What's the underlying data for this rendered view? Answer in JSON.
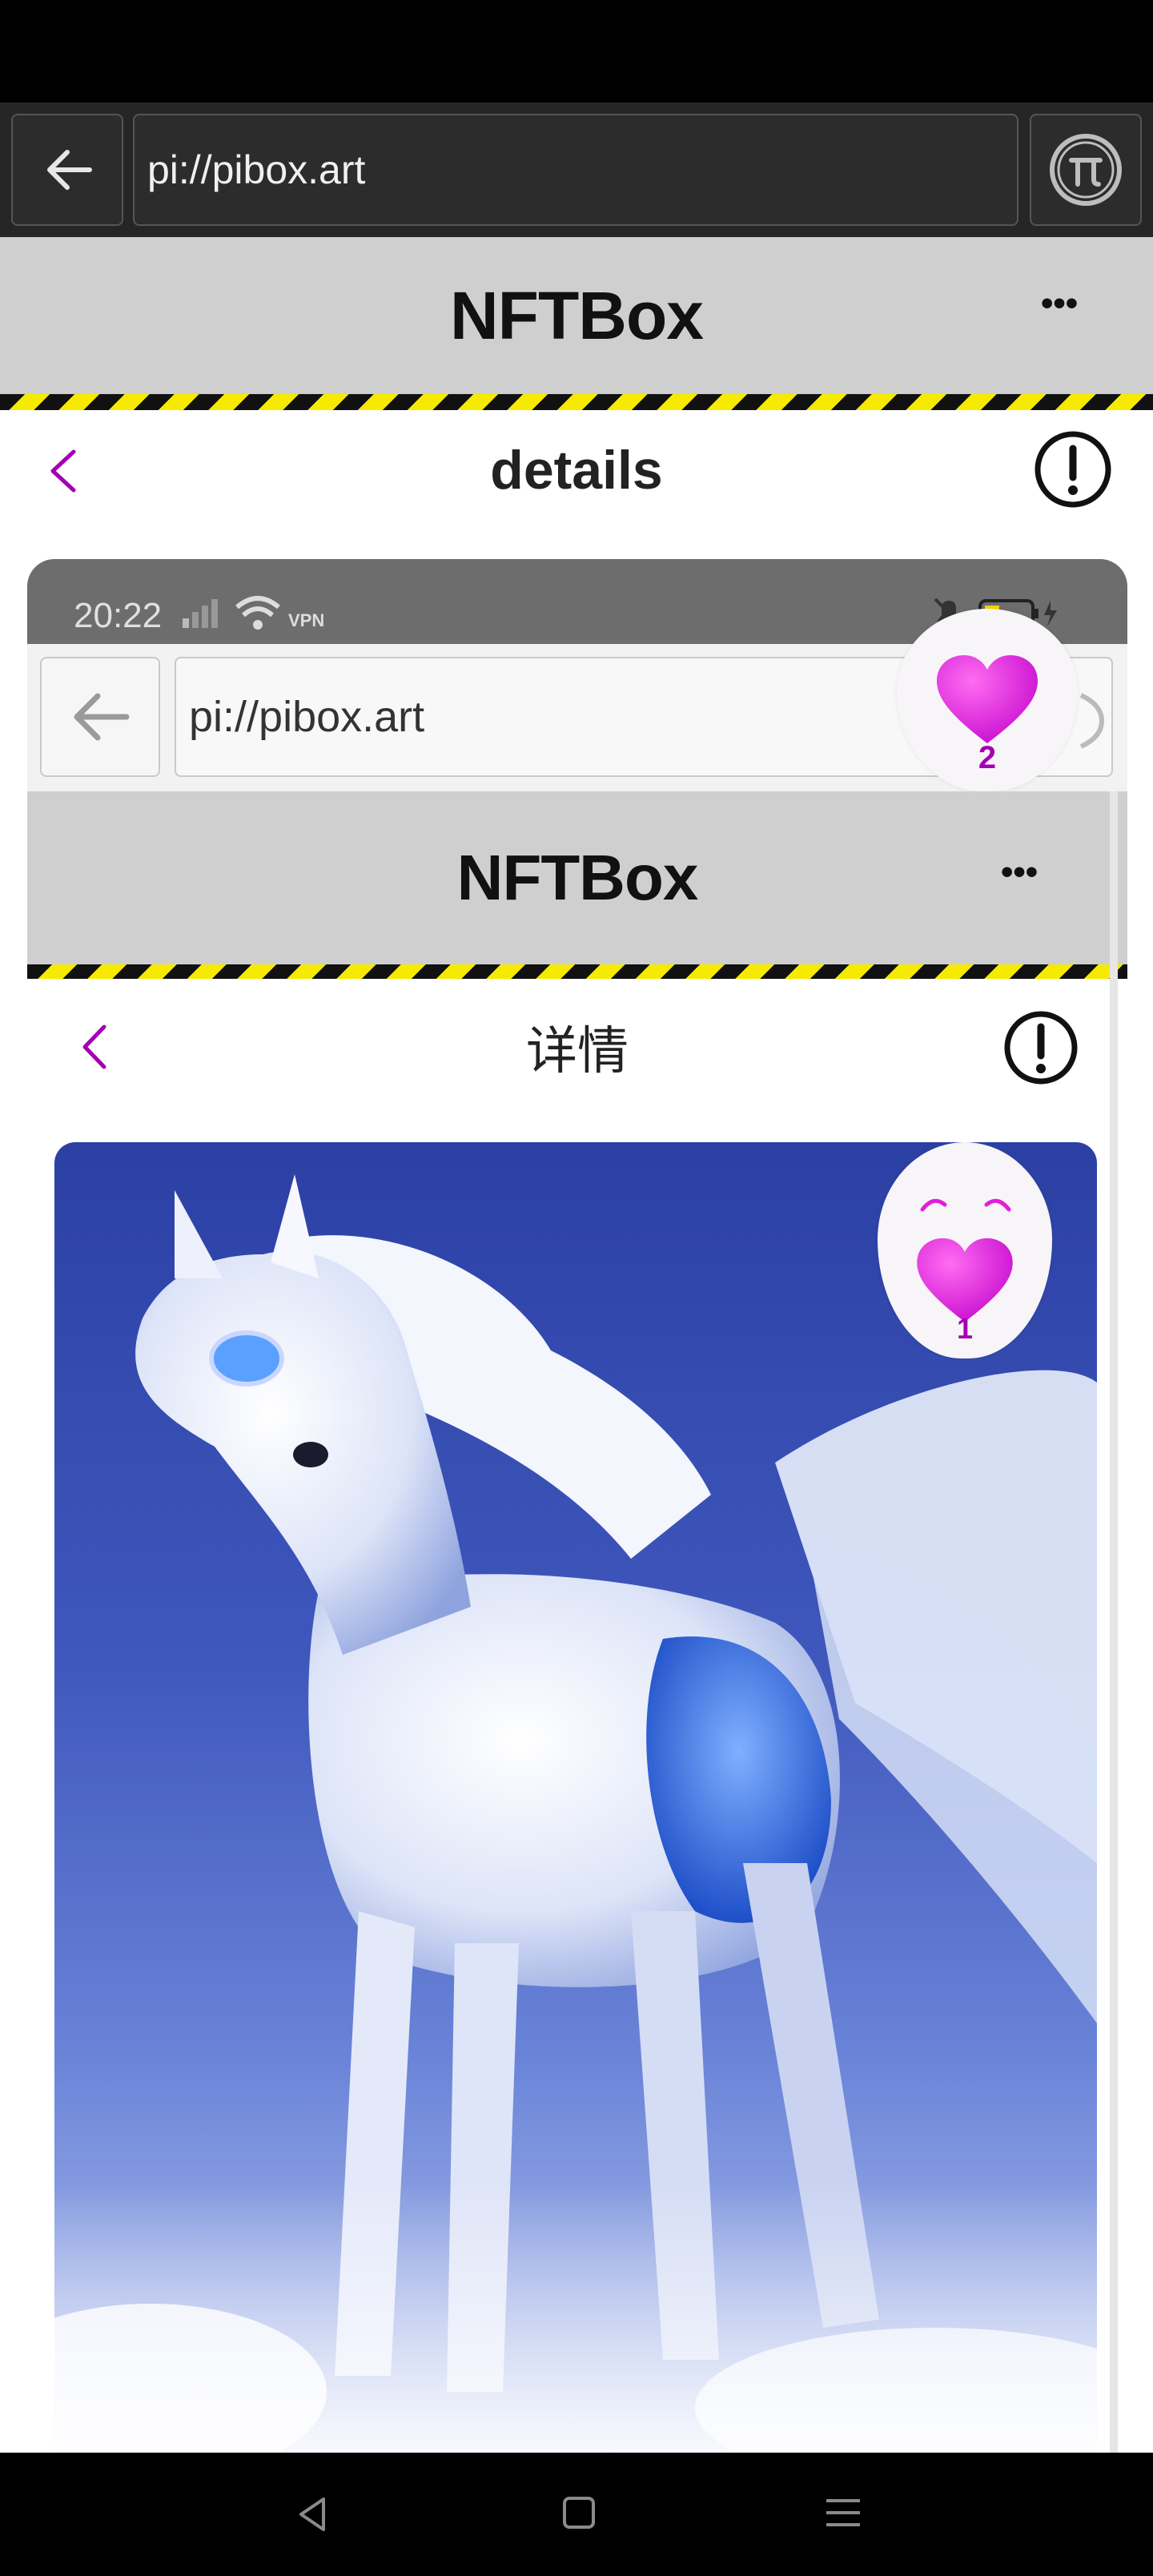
{
  "browser": {
    "url": "pi://pibox.art"
  },
  "site": {
    "title": "NFTBox",
    "more": "•••"
  },
  "page": {
    "title": "details"
  },
  "screenshot": {
    "status_time": "20:22",
    "status_vpn": "VPN",
    "browser_url": "pi://pibox.art",
    "site_title": "NFTBox",
    "more": "•••",
    "page_title": "详情",
    "like_count_top": "2",
    "like_count_image": "1"
  },
  "colors": {
    "accent": "#a300b5",
    "heart": "#d21ad6",
    "hazard_yellow": "#f5ea00",
    "header_gray": "#cfcfcf"
  }
}
